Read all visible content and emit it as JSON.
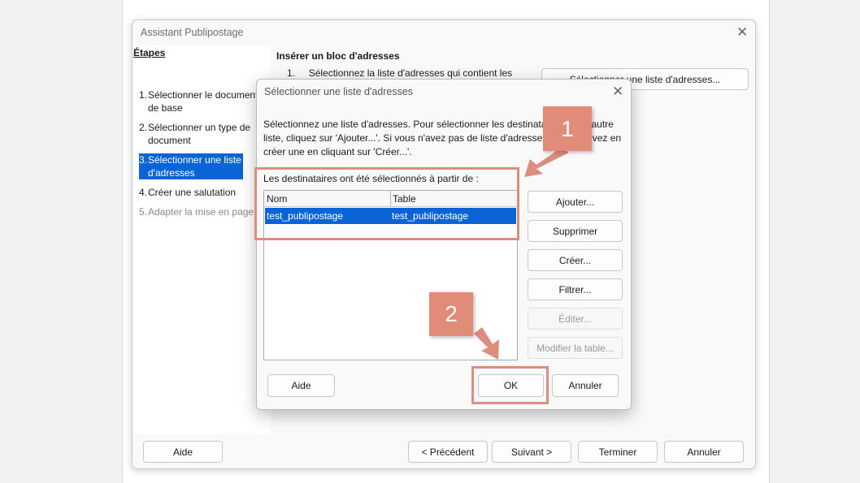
{
  "wizard": {
    "title": "Assistant Publipostage",
    "steps_heading": "Étapes",
    "steps": [
      {
        "num": "1.",
        "label": "Sélectionner le document de base",
        "state": "normal"
      },
      {
        "num": "2.",
        "label": "Sélectionner un type de document",
        "state": "normal"
      },
      {
        "num": "3.",
        "label": "Sélectionner une liste d'adresses",
        "state": "active"
      },
      {
        "num": "4.",
        "label": "Créer une salutation",
        "state": "normal"
      },
      {
        "num": "5.",
        "label": "Adapter la mise en page",
        "state": "disabled"
      }
    ],
    "content_heading": "Insérer un bloc d'adresses",
    "content_line_num": "1.",
    "content_line": "Sélectionnez la liste d'adresses qui contient les",
    "select_list_button": "Sélectionner une liste d'adresses...",
    "footer": {
      "help": "Aide",
      "previous": "< Précédent",
      "next": "Suivant >",
      "finish": "Terminer",
      "cancel": "Annuler"
    }
  },
  "dialog": {
    "title": "Sélectionner une liste d'adresses",
    "description": "Sélectionnez une liste d'adresses. Pour sélectionner les destinataires d'une autre liste, cliquez sur 'Ajouter...'. Si vous n'avez pas de liste d'adresses, vous pouvez en créer une en cliquant sur 'Créer...'.",
    "list_label": "Les destinataires ont été sélectionnés à partir de :",
    "columns": [
      "Nom",
      "Table"
    ],
    "rows": [
      {
        "nom": "test_publipostage",
        "table": "test_publipostage",
        "selected": true
      }
    ],
    "side_buttons": {
      "add": "Ajouter...",
      "remove": "Supprimer",
      "create": "Créer...",
      "filter": "Filtrer...",
      "edit": "Éditer...",
      "modify_table": "Modifier la table..."
    },
    "footer": {
      "help": "Aide",
      "ok": "OK",
      "cancel": "Annuler"
    }
  },
  "annotations": {
    "badge1": "1",
    "badge2": "2",
    "color": "#e18c79"
  },
  "colors": {
    "selection": "#0a64d6",
    "annotation": "#dd8d7e"
  }
}
